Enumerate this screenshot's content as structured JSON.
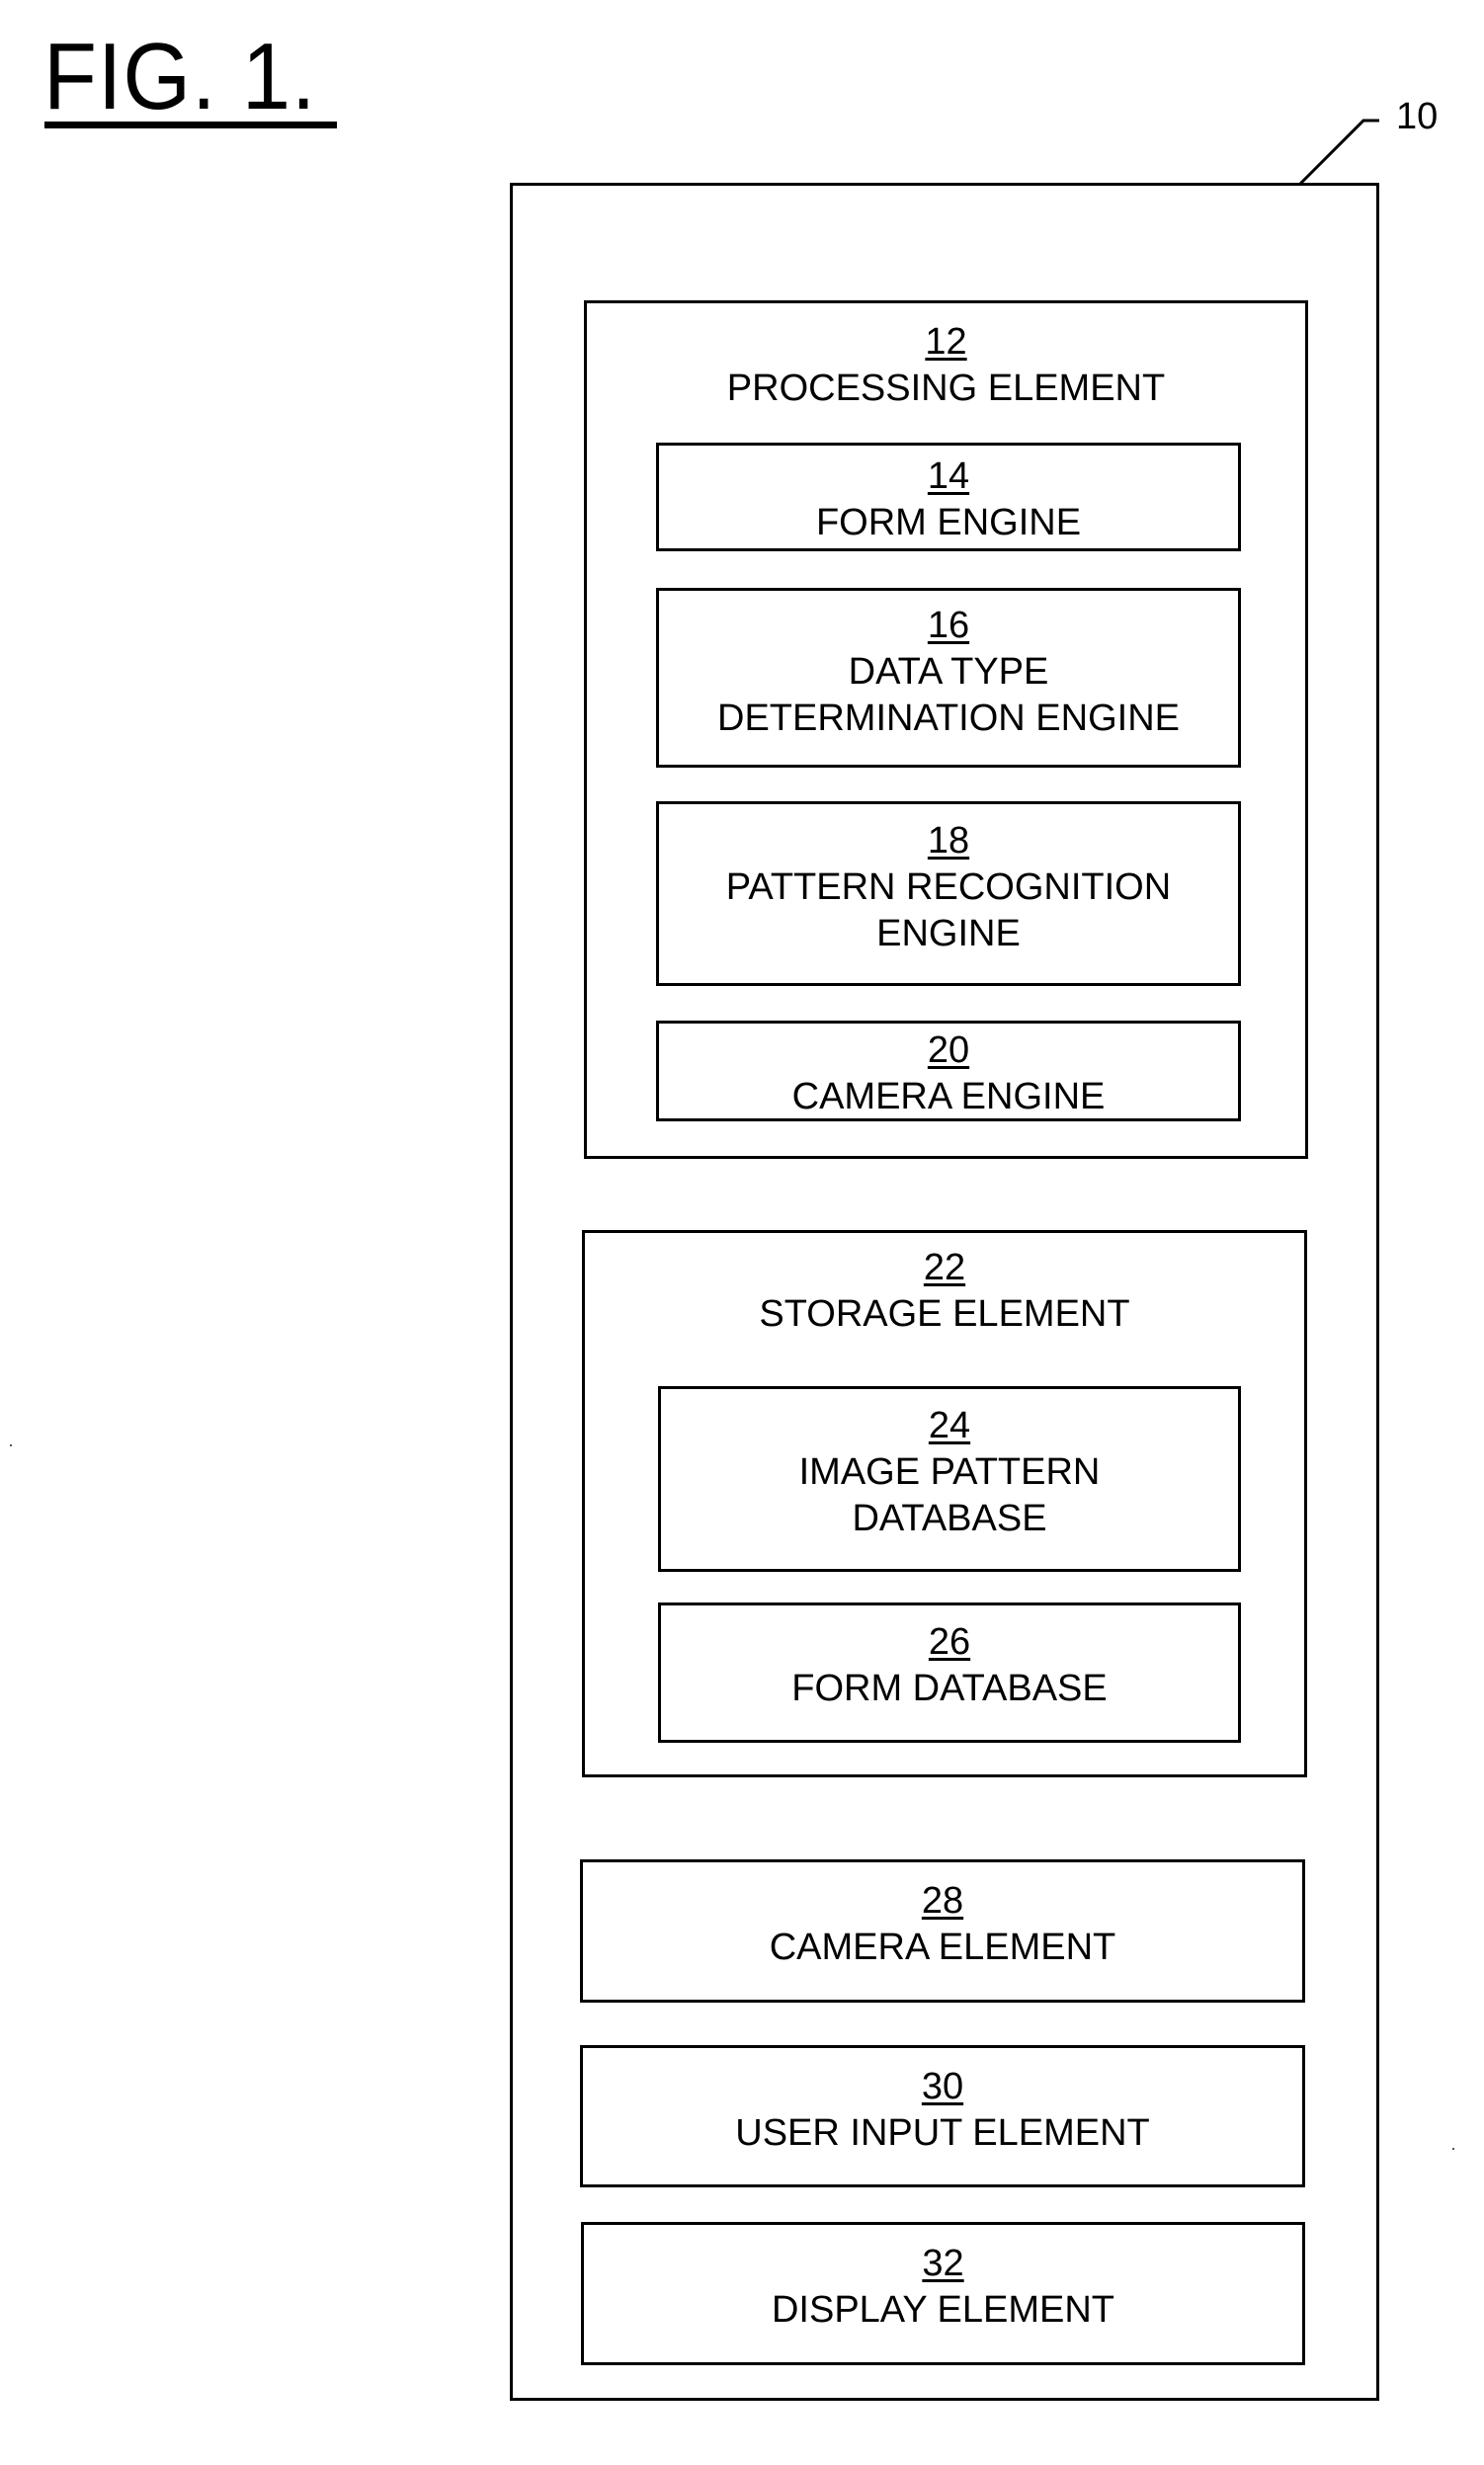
{
  "figure": {
    "title": "FIG. 1.",
    "reference": "10"
  },
  "processing": {
    "number": "12",
    "label": "PROCESSING ELEMENT",
    "children": [
      {
        "number": "14",
        "label": "FORM ENGINE"
      },
      {
        "number": "16",
        "label": "DATA TYPE\nDETERMINATION ENGINE"
      },
      {
        "number": "18",
        "label": "PATTERN RECOGNITION\nENGINE"
      },
      {
        "number": "20",
        "label": "CAMERA ENGINE"
      }
    ]
  },
  "storage": {
    "number": "22",
    "label": "STORAGE ELEMENT",
    "children": [
      {
        "number": "24",
        "label": "IMAGE PATTERN\nDATABASE"
      },
      {
        "number": "26",
        "label": "FORM DATABASE"
      }
    ]
  },
  "other_elements": [
    {
      "number": "28",
      "label": "CAMERA ELEMENT"
    },
    {
      "number": "30",
      "label": "USER INPUT ELEMENT"
    },
    {
      "number": "32",
      "label": "DISPLAY ELEMENT"
    }
  ]
}
